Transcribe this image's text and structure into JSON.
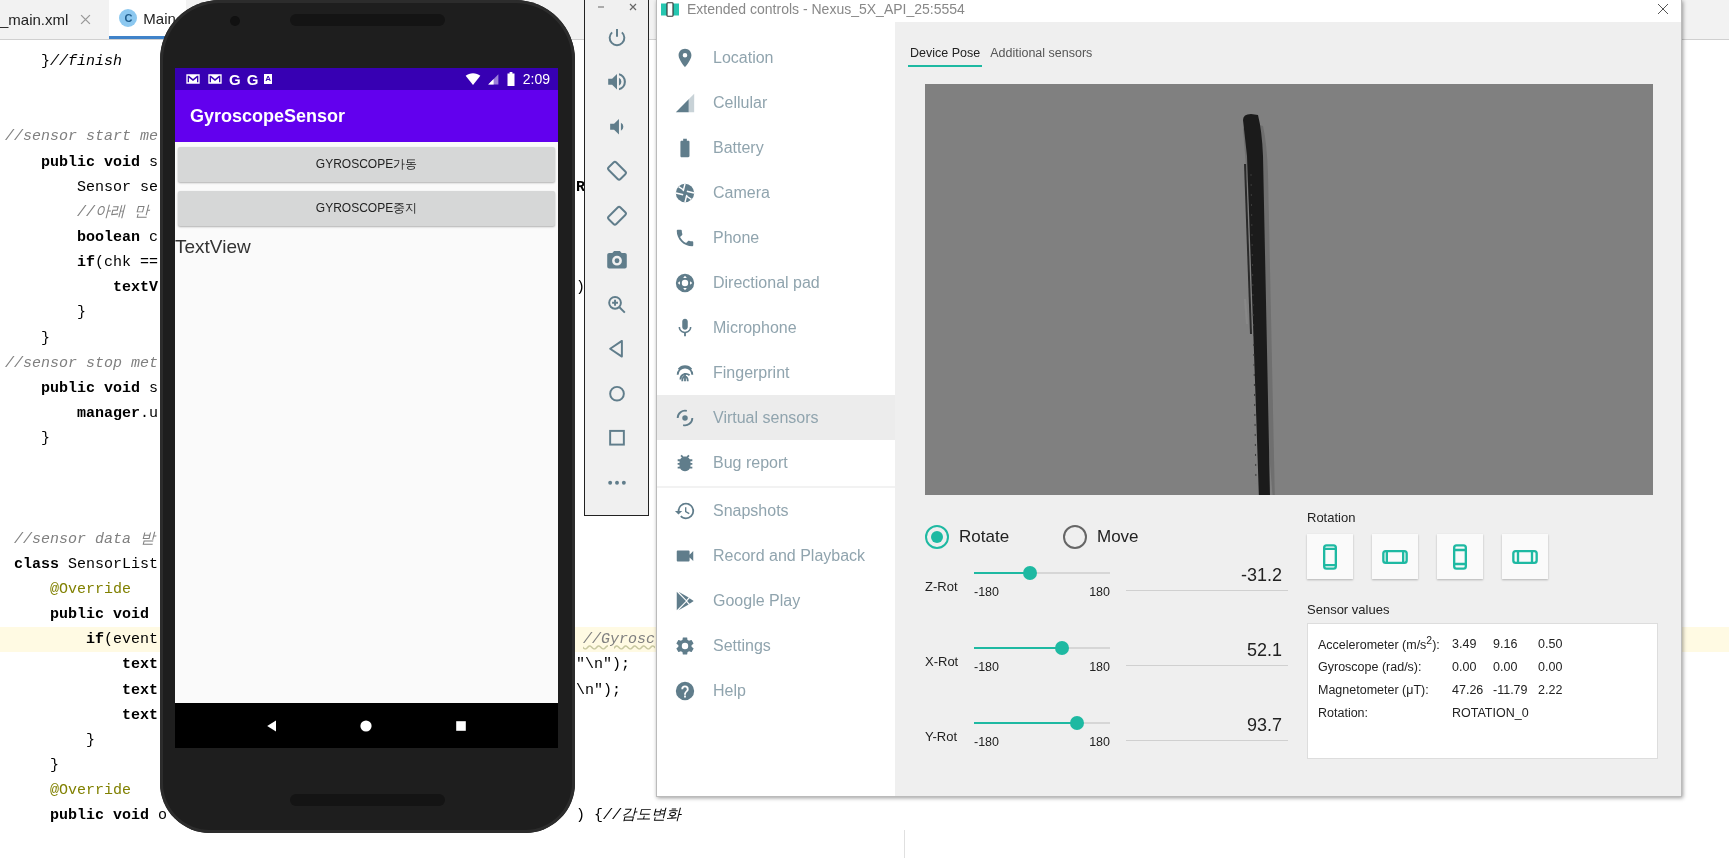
{
  "ide": {
    "tabs": [
      {
        "label": "_main.xml",
        "selected": false
      },
      {
        "label": "Main",
        "selected": true,
        "icon_letter": "C"
      }
    ],
    "lines": [
      {
        "kind": "code",
        "text": "    }*//finish*",
        "current": false
      },
      {
        "kind": "blank",
        "current": false
      },
      {
        "kind": "blank",
        "current": false
      },
      {
        "kind": "comment",
        "text": "//sensor start me",
        "current": false
      },
      {
        "kind": "code",
        "text": "    **public void** s",
        "current": false
      },
      {
        "kind": "code",
        "text": "        Sensor se",
        "current": false,
        "right": {
          "kind": "field",
          "text": "**R**"
        }
      },
      {
        "kind": "comment",
        "text": "        //아래 만",
        "current": false
      },
      {
        "kind": "code",
        "text": "        **boolean** c",
        "current": false
      },
      {
        "kind": "code",
        "text": "        **if**(chk ==",
        "current": false
      },
      {
        "kind": "field",
        "text": "            **textV**",
        "current": false,
        "right": {
          "kind": "code",
          "text": ")"
        }
      },
      {
        "kind": "code",
        "text": "        }",
        "current": false
      },
      {
        "kind": "code",
        "text": "    }",
        "current": false
      },
      {
        "kind": "comment",
        "text": "//sensor stop met",
        "current": false
      },
      {
        "kind": "code",
        "text": "    **public void** s",
        "current": false
      },
      {
        "kind": "field",
        "text": "        **manager**.u",
        "current": false
      },
      {
        "kind": "code",
        "text": "    }",
        "current": false
      },
      {
        "kind": "blank",
        "current": false
      },
      {
        "kind": "blank",
        "current": false
      },
      {
        "kind": "blank",
        "current": false
      },
      {
        "kind": "comment",
        "text": " //sensor data 받",
        "current": false
      },
      {
        "kind": "code",
        "text": " **class** SensorList",
        "current": false
      },
      {
        "kind": "annotation",
        "text": "     @Override",
        "current": false
      },
      {
        "kind": "code",
        "text": "     **public void**",
        "current": false
      },
      {
        "kind": "code",
        "text": "         **if**(event",
        "current": true,
        "right": {
          "kind": "comment",
          "text": "//Gyrosc"
        }
      },
      {
        "kind": "field",
        "text": "             **text**",
        "current": false,
        "right": {
          "kind": "code",
          "text": "\"\\n\");"
        }
      },
      {
        "kind": "field",
        "text": "             **text**",
        "current": false,
        "right": {
          "kind": "code",
          "text": "\\n\");"
        }
      },
      {
        "kind": "field",
        "text": "             **text**",
        "current": false
      },
      {
        "kind": "code",
        "text": "         }",
        "current": false
      },
      {
        "kind": "code",
        "text": "     }",
        "current": false
      },
      {
        "kind": "annotation",
        "text": "     @Override",
        "current": false
      },
      {
        "kind": "code",
        "text": "     **public void** o",
        "current": false,
        "right": {
          "kind": "code",
          "text": ") {*//감도변화*"
        }
      }
    ]
  },
  "phone": {
    "notifications": [
      {
        "kind": "mail"
      },
      {
        "kind": "mail"
      },
      {
        "kind": "letter",
        "text": "G"
      },
      {
        "kind": "letter",
        "text": "G"
      },
      {
        "kind": "badge",
        "text": "A"
      }
    ],
    "time": "2:09",
    "app_title": "GyroscopeSensor",
    "buttons": [
      "GYROSCOPE가동",
      "GYROSCOPE중지"
    ],
    "text_view": "TextView"
  },
  "emulator_toolbar": {
    "buttons": [
      {
        "kind": "power"
      },
      {
        "kind": "volume-up"
      },
      {
        "kind": "volume-down"
      },
      {
        "kind": "rotate-left"
      },
      {
        "kind": "rotate-right"
      },
      {
        "kind": "camera"
      },
      {
        "kind": "zoom"
      },
      {
        "kind": "back"
      },
      {
        "kind": "home"
      },
      {
        "kind": "overview"
      },
      {
        "kind": "more"
      }
    ]
  },
  "extended_controls": {
    "title": "Extended controls - Nexus_5X_API_25:5554",
    "sidebar": [
      {
        "items": [
          {
            "label": "Location",
            "kind": "location-pin",
            "selected": false
          },
          {
            "label": "Cellular",
            "kind": "signal",
            "selected": false
          },
          {
            "label": "Battery",
            "kind": "battery",
            "selected": false
          },
          {
            "label": "Camera",
            "kind": "aperture",
            "selected": false
          },
          {
            "label": "Phone",
            "kind": "phone",
            "selected": false
          },
          {
            "label": "Directional pad",
            "kind": "dpad",
            "selected": false
          },
          {
            "label": "Microphone",
            "kind": "microphone",
            "selected": false
          },
          {
            "label": "Fingerprint",
            "kind": "fingerprint",
            "selected": false
          },
          {
            "label": "Virtual sensors",
            "kind": "sensor",
            "selected": true
          },
          {
            "label": "Bug report",
            "kind": "bug",
            "selected": false
          }
        ]
      },
      {
        "items": [
          {
            "label": "Snapshots",
            "kind": "history",
            "selected": false
          },
          {
            "label": "Record and Playback",
            "kind": "video-camera",
            "selected": false
          },
          {
            "label": "Google Play",
            "kind": "play-triangle",
            "selected": false
          },
          {
            "label": "Settings",
            "kind": "settings",
            "selected": false
          },
          {
            "label": "Help",
            "kind": "help",
            "selected": false
          }
        ]
      }
    ],
    "tabs": [
      {
        "label": "Device Pose",
        "selected": true
      },
      {
        "label": "Additional sensors",
        "selected": false
      }
    ],
    "modes": [
      {
        "label": "Rotate",
        "selected": true
      },
      {
        "label": "Move",
        "selected": false
      }
    ],
    "sliders": [
      {
        "label": "Z-Rot",
        "level": 0.413,
        "min": "-180",
        "max": "180",
        "reading": "-31.2"
      },
      {
        "label": "X-Rot",
        "level": 0.645,
        "min": "-180",
        "max": "180",
        "reading": "52.1"
      },
      {
        "label": "Y-Rot",
        "level": 0.76,
        "min": "-180",
        "max": "180",
        "reading": "93.7"
      }
    ],
    "rotation": {
      "title": "Rotation",
      "buttons": [
        {
          "kind": "portrait"
        },
        {
          "kind": "landscape"
        },
        {
          "kind": "reverse-portrait"
        },
        {
          "kind": "reverse-landscape"
        }
      ]
    },
    "sensor_values": {
      "title": "Sensor values",
      "rows": [
        {
          "label": "Accelerometer (m/s$^{2}$):",
          "values": [
            "3.49",
            "9.16",
            "0.50"
          ]
        },
        {
          "label": "Gyroscope (rad/s):",
          "values": [
            "0.00",
            "0.00",
            "0.00"
          ]
        },
        {
          "label": "Magnetometer (μT):",
          "values": [
            "47.26",
            "-11.79",
            "2.22"
          ]
        },
        {
          "label": "Rotation:",
          "values": [
            "ROTATION_0"
          ]
        }
      ]
    }
  }
}
